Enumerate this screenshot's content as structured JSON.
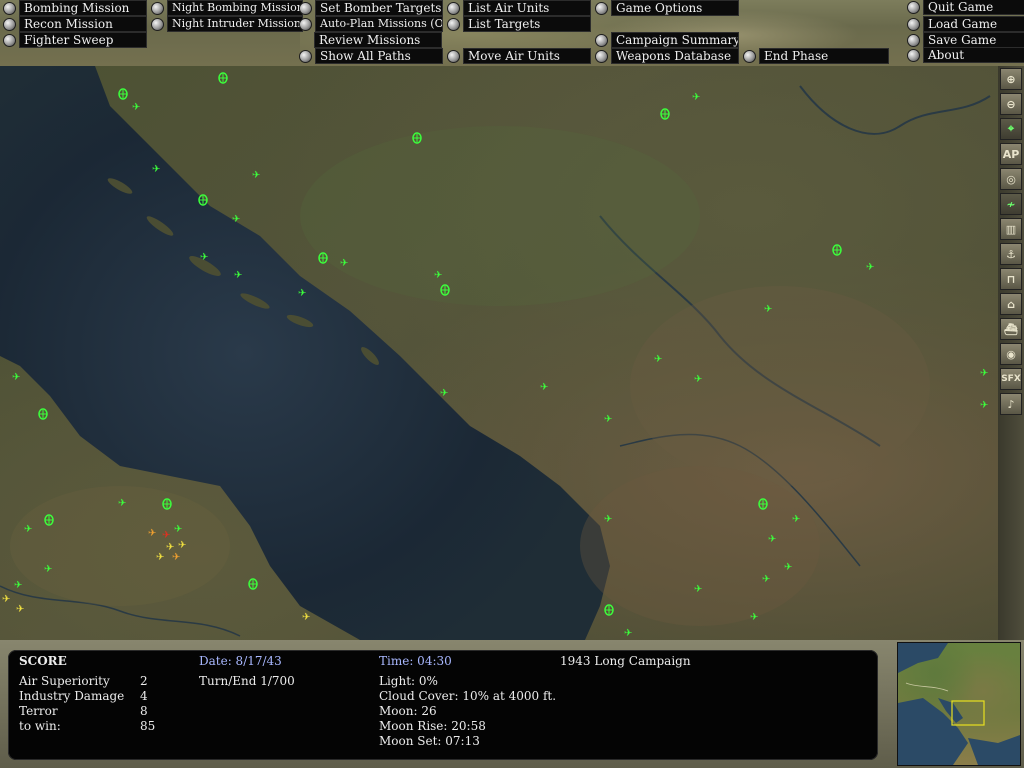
{
  "menu": {
    "col1": [
      "Bombing Mission",
      "Recon Mission",
      "Fighter Sweep"
    ],
    "col2": [
      "Night Bombing Mission",
      "Night Intruder Mission"
    ],
    "col3": [
      "Set Bomber Targets",
      "Auto-Plan Missions (Off)",
      "Review Missions",
      "Show All Paths"
    ],
    "col4": [
      "List Air Units",
      "List Targets",
      "Move Air Units"
    ],
    "col5": [
      "Game Options",
      "Campaign Summary",
      "Weapons Database"
    ],
    "col6": [
      "End Phase"
    ],
    "col7": [
      "Quit Game",
      "Load Game",
      "Save Game",
      "About"
    ]
  },
  "toolbar": {
    "buttons": [
      {
        "name": "zoom-in-icon",
        "glyph": "⊕"
      },
      {
        "name": "zoom-out-icon",
        "glyph": "⊖"
      },
      {
        "name": "crosshair-icon",
        "glyph": "⌖"
      },
      {
        "name": "ap-button",
        "glyph": "AP"
      },
      {
        "name": "target-icon",
        "glyph": "◎"
      },
      {
        "name": "flight-path-icon",
        "glyph": "≁"
      },
      {
        "name": "factory-icon",
        "glyph": "▥"
      },
      {
        "name": "anchor-icon",
        "glyph": "⚓"
      },
      {
        "name": "bridge-icon",
        "glyph": "⊓"
      },
      {
        "name": "building-icon",
        "glyph": "⌂"
      },
      {
        "name": "ship-icon",
        "glyph": "⛴"
      },
      {
        "name": "compass-icon",
        "glyph": "◉"
      },
      {
        "name": "sfx-button",
        "glyph": "SFX"
      },
      {
        "name": "music-icon",
        "glyph": "♪"
      }
    ]
  },
  "score": {
    "title": "SCORE",
    "rows": [
      {
        "label": "Air Superiority",
        "value": "2"
      },
      {
        "label": "Industry Damage",
        "value": "4"
      },
      {
        "label": "Terror",
        "value": "8"
      },
      {
        "label": "to win:",
        "value": "85"
      }
    ]
  },
  "status": {
    "date": "Date: 8/17/43",
    "turn": "Turn/End 1/700",
    "time": "Time: 04:30",
    "campaign": "1943 Long Campaign",
    "light": "Light: 0%",
    "cloud": "Cloud Cover: 10% at 4000 ft.",
    "moon": "Moon: 26",
    "moon_rise": "Moon Rise: 20:58",
    "moon_set": "Moon Set: 07:13"
  },
  "colors": {
    "friendly_unit": "#3cff3c",
    "enemy_unit_yellow": "#f0e040",
    "enemy_unit_red": "#e03020",
    "sea": "#1c2b3a",
    "land": "#4f5236"
  }
}
